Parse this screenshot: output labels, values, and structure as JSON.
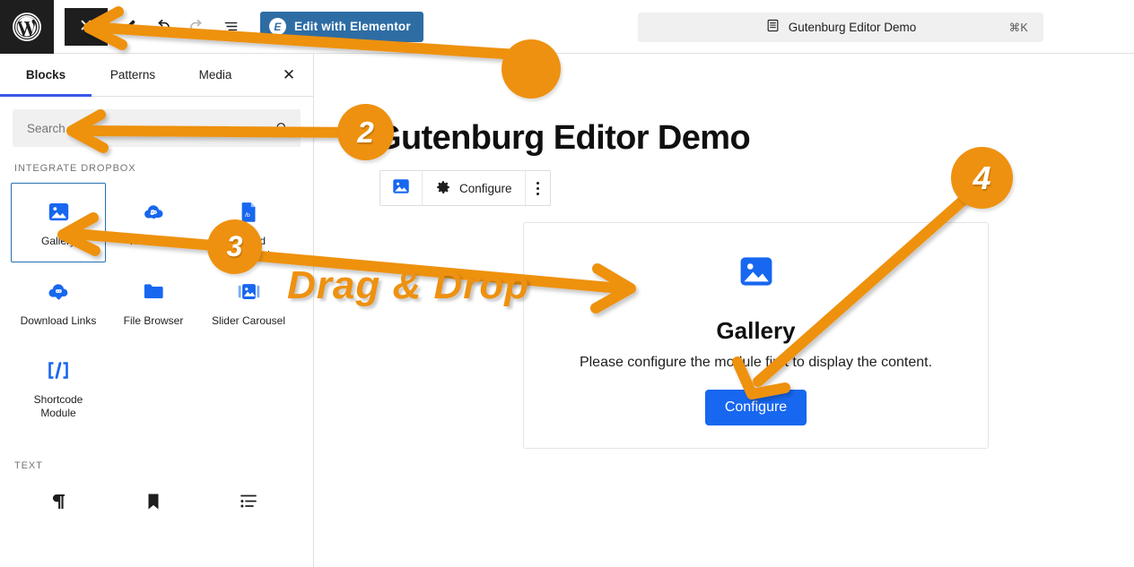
{
  "topbar": {
    "wp_logo_icon": "wordpress-logo-icon",
    "close_label": "✕",
    "close_icon": "close-icon",
    "edit_icon": "pencil-edit-icon",
    "undo_icon": "undo-icon",
    "redo_icon": "redo-icon",
    "outline_icon": "document-outline-icon",
    "elementor": {
      "badge": "E",
      "label": "Edit with Elementor",
      "color": "#2e6da4"
    },
    "command_palette": {
      "icon": "document-icon",
      "label": "Gutenburg Editor Demo",
      "shortcut": "⌘K"
    }
  },
  "inserter": {
    "tabs": [
      {
        "label": "Blocks",
        "active": true
      },
      {
        "label": "Patterns",
        "active": false
      },
      {
        "label": "Media",
        "active": false
      }
    ],
    "close_icon": "close-icon",
    "close_label": "✕",
    "search": {
      "placeholder": "Search",
      "value": "",
      "icon": "search-icon"
    },
    "categories": [
      {
        "title": "INTEGRATE DROPBOX",
        "blocks": [
          {
            "label": "Gallery",
            "icon": "image-gallery-icon",
            "selected": true
          },
          {
            "label": "View Links",
            "icon": "link-cloud-icon",
            "selected": false
          },
          {
            "label": "Embed Documents",
            "icon": "document-file-icon",
            "selected": false
          },
          {
            "label": "Download Links",
            "icon": "download-cloud-icon",
            "selected": false
          },
          {
            "label": "File Browser",
            "icon": "folder-icon",
            "selected": false
          },
          {
            "label": "Slider Carousel",
            "icon": "slider-image-icon",
            "selected": false
          },
          {
            "label": "Shortcode Module",
            "icon": "shortcode-brackets-icon",
            "selected": false
          }
        ]
      },
      {
        "title": "TEXT",
        "blocks": [
          {
            "label": "",
            "icon": "paragraph-icon",
            "selected": false
          },
          {
            "label": "",
            "icon": "heading-bookmark-icon",
            "selected": false
          },
          {
            "label": "",
            "icon": "list-icon",
            "selected": false
          }
        ]
      }
    ]
  },
  "canvas": {
    "post_title": "Gutenburg Editor Demo",
    "block_toolbar": {
      "block_icon": "image-gallery-icon",
      "configure_label": "Configure",
      "configure_icon": "gear-icon",
      "more_icon": "more-options-vertical-dots-icon"
    },
    "gallery_block": {
      "icon": "image-gallery-icon",
      "title": "Gallery",
      "description": "Please configure the module first to display the content.",
      "button_label": "Configure",
      "button_color": "#1767f0"
    }
  },
  "annotations": {
    "accent_color": "#ee9110",
    "drag_drop_text": "Drag & Drop",
    "badges": [
      {
        "number": "",
        "name": "step-badge-1"
      },
      {
        "number": "2",
        "name": "step-badge-2"
      },
      {
        "number": "3",
        "name": "step-badge-3"
      },
      {
        "number": "4",
        "name": "step-badge-4"
      }
    ]
  }
}
